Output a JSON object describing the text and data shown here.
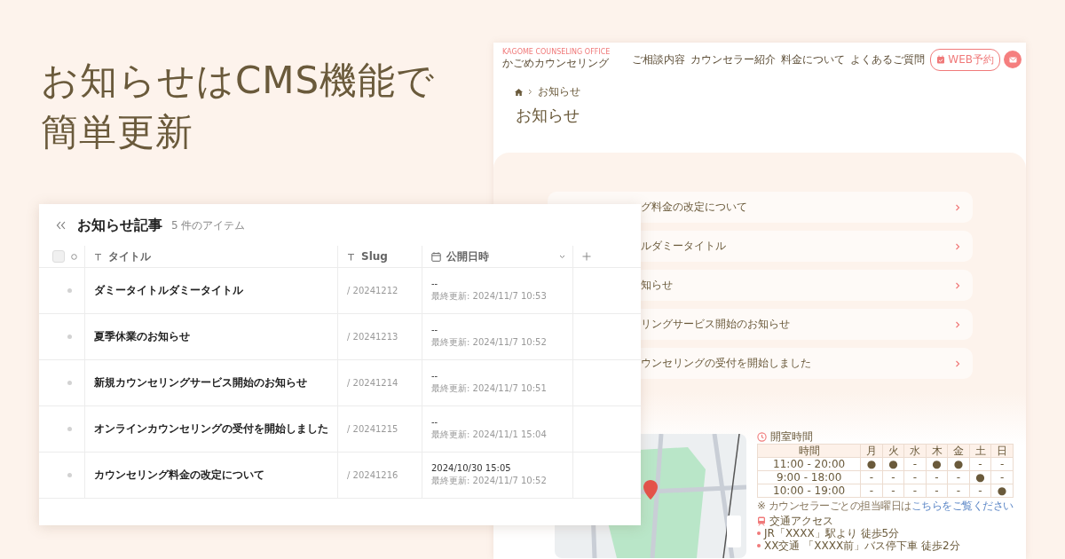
{
  "headline": [
    "お知らせはCMS機能で",
    "簡単更新"
  ],
  "website": {
    "logo_sub": "KAGOME COUNSELING OFFICE",
    "logo": "かごめカウンセリング",
    "nav": [
      "ご相談内容",
      "カウンセラー紹介",
      "料金について",
      "よくあるご質問"
    ],
    "reserve_button": "WEB予約",
    "breadcrumb": "お知らせ",
    "page_title": "お知らせ",
    "news_items": [
      "グ料金の改定について",
      "ルダミータイトル",
      "知らせ",
      "リングサービス開始のお知らせ",
      "ウンセリングの受付を開始しました"
    ],
    "hours": {
      "title": "開室時間",
      "columns": [
        "時間",
        "月",
        "火",
        "水",
        "木",
        "金",
        "土",
        "日"
      ],
      "rows": [
        [
          "11:00 - 20:00",
          "●",
          "●",
          "-",
          "●",
          "●",
          "-",
          "-"
        ],
        [
          "9:00 - 18:00",
          "-",
          "-",
          "-",
          "-",
          "-",
          "●",
          "-"
        ],
        [
          "10:00 - 19:00",
          "-",
          "-",
          "-",
          "-",
          "-",
          "-",
          "●"
        ]
      ]
    },
    "note": {
      "text": "※ カウンセラーごとの担当曜日は",
      "link": "こちらをご覧ください"
    },
    "access": {
      "title": "交通アクセス",
      "items": [
        "JR「XXXX」駅より 徒歩5分",
        "XX交通 「XXXX前」バス停下車 徒歩2分"
      ]
    }
  },
  "cms": {
    "title": "お知らせ記事",
    "count": "5 件のアイテム",
    "select_all": {
      "checked": false
    },
    "columns": [
      {
        "kind": "text",
        "label": "タイトル"
      },
      {
        "kind": "text",
        "label": "Slug"
      },
      {
        "kind": "date",
        "label": "公開日時"
      }
    ],
    "rows": [
      {
        "title": "ダミータイトルダミータイトル",
        "slug": "/ 20241212",
        "published": "--",
        "updated": "最終更新: 2024/11/7 10:53"
      },
      {
        "title": "夏季休業のお知らせ",
        "slug": "/ 20241213",
        "published": "--",
        "updated": "最終更新: 2024/11/7 10:52"
      },
      {
        "title": "新規カウンセリングサービス開始のお知らせ",
        "slug": "/ 20241214",
        "published": "--",
        "updated": "最終更新: 2024/11/7 10:51"
      },
      {
        "title": "オンラインカウンセリングの受付を開始しました",
        "slug": "/ 20241215",
        "published": "--",
        "updated": "最終更新: 2024/11/1 15:04"
      },
      {
        "title": "カウンセリング料金の改定について",
        "slug": "/ 20241216",
        "published": "2024/10/30 15:05",
        "updated": "最終更新: 2024/11/7 10:52"
      }
    ]
  }
}
